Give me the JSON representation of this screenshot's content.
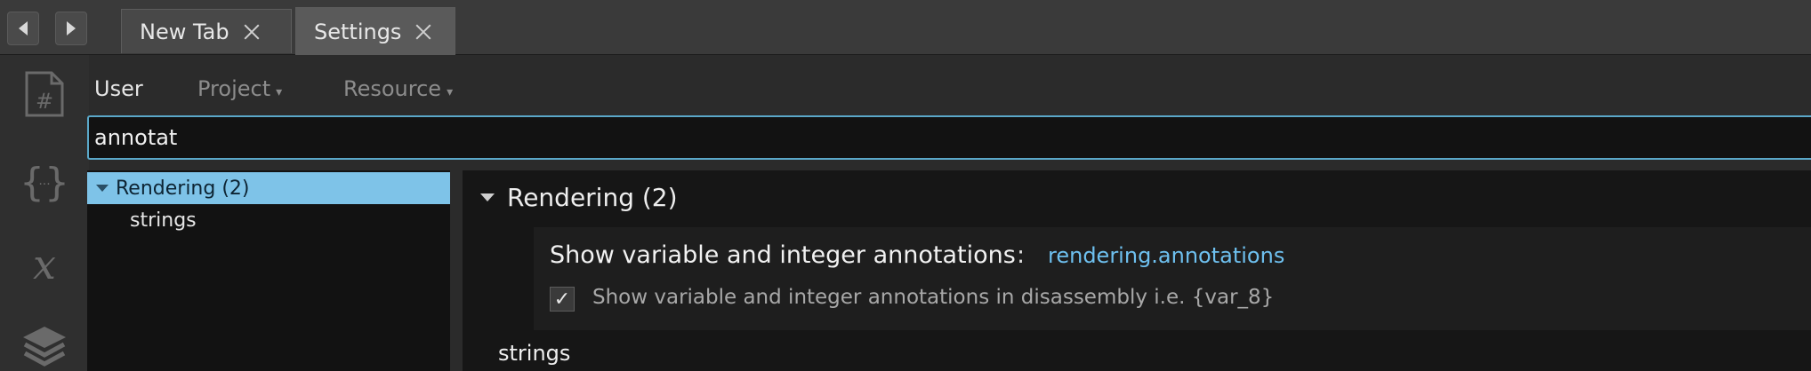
{
  "tabs": [
    {
      "label": "New Tab",
      "active": false
    },
    {
      "label": "Settings",
      "active": true
    }
  ],
  "sidebar": {
    "icons": [
      "hash-file-icon",
      "braces-icon",
      "variable-x-icon",
      "layers-icon"
    ]
  },
  "scope": {
    "user": "User",
    "project": "Project",
    "resource": "Resource"
  },
  "search": {
    "value": "annotat"
  },
  "tree": {
    "items": [
      {
        "label": "Rendering (2)",
        "selected": true
      },
      {
        "label": "strings",
        "selected": false
      }
    ]
  },
  "main": {
    "section_title": "Rendering (2)",
    "setting": {
      "title": "Show variable and integer annotations",
      "separator": ":",
      "key": "rendering.annotations",
      "checkbox_checked": true,
      "description": "Show variable and integer annotations in disassembly i.e. {var_8}"
    },
    "next_section": "strings"
  },
  "colors": {
    "accent": "#5aa7c8",
    "selection": "#7ec3e8",
    "link": "#6ec0ef"
  }
}
